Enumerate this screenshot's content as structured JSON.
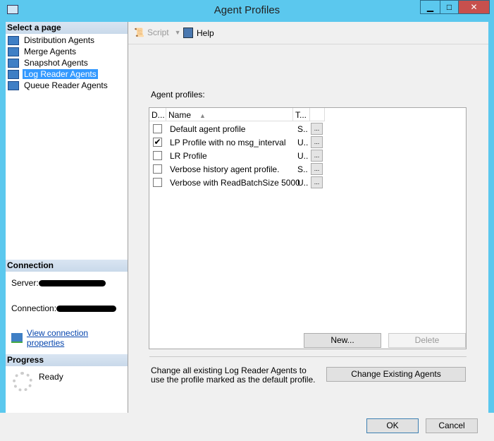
{
  "window": {
    "title": "Agent Profiles",
    "minimize": "▁",
    "maximize": "□",
    "close": "✕"
  },
  "sidebar": {
    "select_header": "Select a page",
    "pages": [
      {
        "label": "Distribution Agents"
      },
      {
        "label": "Merge Agents"
      },
      {
        "label": "Snapshot Agents"
      },
      {
        "label": "Log Reader Agents",
        "selected": true
      },
      {
        "label": "Queue Reader Agents"
      }
    ],
    "connection_header": "Connection",
    "server_label": "Server:",
    "connection_label": "Connection:",
    "view_props": "View connection properties",
    "progress_header": "Progress",
    "progress_status": "Ready"
  },
  "toolbar": {
    "script": "Script",
    "help": "Help"
  },
  "main": {
    "profiles_label": "Agent profiles:",
    "columns": [
      "D...",
      "Name",
      "T..."
    ],
    "rows": [
      {
        "checked": false,
        "name": "Default agent profile",
        "type": "S..",
        "more": "..."
      },
      {
        "checked": true,
        "name": "LP Profile with no msg_interval",
        "type": "U..",
        "more": "..."
      },
      {
        "checked": false,
        "name": "LR Profile",
        "type": "U..",
        "more": "..."
      },
      {
        "checked": false,
        "name": "Verbose history agent profile.",
        "type": "S..",
        "more": "..."
      },
      {
        "checked": false,
        "name": "Verbose with ReadBatchSize 5000",
        "type": "U..",
        "more": "..."
      }
    ],
    "new": "New...",
    "delete": "Delete",
    "change_text": "Change all existing Log Reader Agents to use the profile marked as the default profile.",
    "change_button": "Change Existing Agents"
  },
  "footer": {
    "ok": "OK",
    "cancel": "Cancel"
  }
}
